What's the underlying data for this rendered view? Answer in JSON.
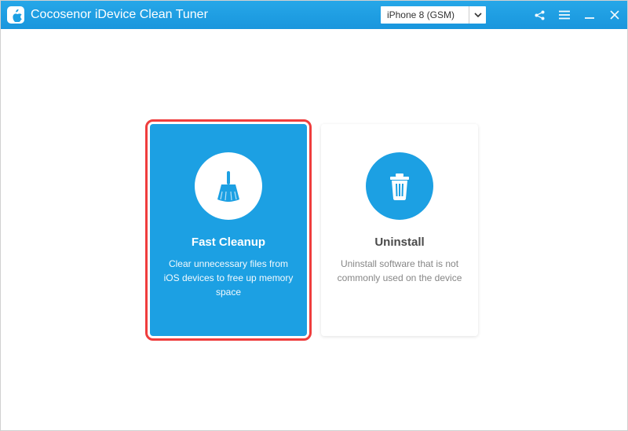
{
  "app": {
    "title": "Cocosenor iDevice Clean Tuner"
  },
  "device_select": {
    "value": "iPhone 8 (GSM)"
  },
  "colors": {
    "accent": "#1ca0e3",
    "titlebar": "#1996dd",
    "highlight": "#ef3d3d"
  },
  "cards": {
    "fast_cleanup": {
      "title": "Fast Cleanup",
      "description": "Clear unnecessary files from iOS devices to free up memory space"
    },
    "uninstall": {
      "title": "Uninstall",
      "description": "Uninstall software that is not commonly used on the device"
    }
  }
}
